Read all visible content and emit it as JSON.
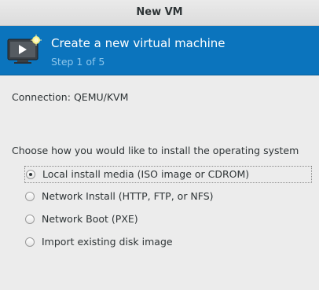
{
  "window": {
    "title": "New VM"
  },
  "banner": {
    "icon": "vm-monitor-icon",
    "title": "Create a new virtual machine",
    "step": "Step 1 of 5"
  },
  "connection": {
    "label": "Connection:",
    "value": "QEMU/KVM"
  },
  "install": {
    "question": "Choose how you would like to install the operating system",
    "options": [
      {
        "label": "Local install media (ISO image or CDROM)",
        "selected": true
      },
      {
        "label": "Network Install (HTTP, FTP, or NFS)",
        "selected": false
      },
      {
        "label": "Network Boot (PXE)",
        "selected": false
      },
      {
        "label": "Import existing disk image",
        "selected": false
      }
    ]
  },
  "colors": {
    "banner_bg": "#0b74bd",
    "banner_step_text": "#8cc6ec",
    "window_bg": "#ececec"
  }
}
